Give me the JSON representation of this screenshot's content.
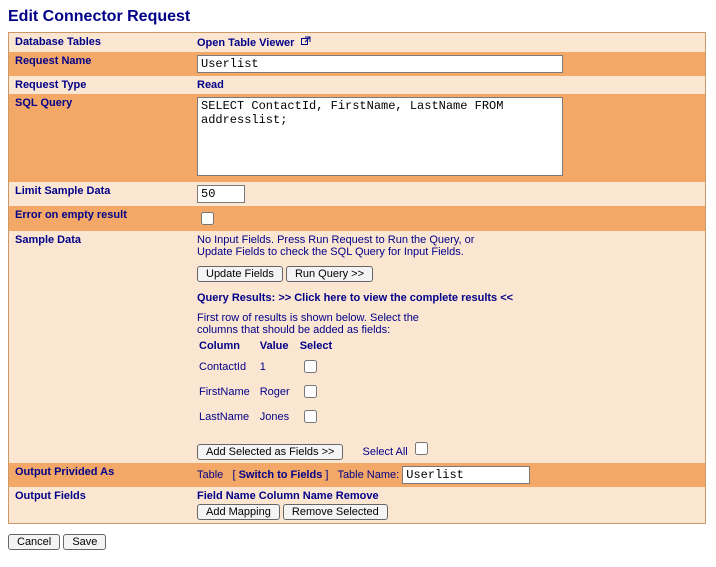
{
  "title": "Edit Connector Request",
  "rows": {
    "databaseTables": {
      "label": "Database Tables",
      "link": "Open Table Viewer"
    },
    "requestName": {
      "label": "Request Name",
      "value": "Userlist"
    },
    "requestType": {
      "label": "Request Type",
      "value": "Read"
    },
    "sqlQuery": {
      "label": "SQL Query",
      "value": "SELECT ContactId, FirstName, LastName FROM addresslist;"
    },
    "limitSample": {
      "label": "Limit Sample Data",
      "value": "50"
    },
    "errorEmpty": {
      "label": "Error on empty result"
    },
    "sampleData": {
      "label": "Sample Data",
      "noInput1": "No Input Fields. Press Run Request to Run the Query, or",
      "noInput2": "Update Fields to check the SQL Query for Input Fields.",
      "updateFieldsBtn": "Update Fields",
      "runQueryBtn": "Run Query >>",
      "resultsHeading": "Query Results:",
      "resultsLink": ">> Click here to view the complete results <<",
      "resultsHint1": "First row of results is shown below. Select the",
      "resultsHint2": "columns that should be added as fields:",
      "gridHeaders": {
        "col": "Column",
        "val": "Value",
        "sel": "Select"
      },
      "gridRows": [
        {
          "col": "ContactId",
          "val": "1"
        },
        {
          "col": "FirstName",
          "val": "Roger"
        },
        {
          "col": "LastName",
          "val": "Jones"
        }
      ],
      "addSelectedBtn": "Add Selected as Fields >>",
      "selectAllLabel": "Select All"
    },
    "outputProvided": {
      "label": "Output Privided As",
      "tableWord": "Table",
      "switchLink": "Switch to Fields",
      "tableNameLabel": "Table Name:",
      "tableNameValue": "Userlist"
    },
    "outputFields": {
      "label": "Output Fields",
      "h1": "Field Name",
      "h2": "Column Name",
      "h3": "Remove",
      "addMappingBtn": "Add Mapping",
      "removeSelectedBtn": "Remove Selected"
    }
  },
  "footer": {
    "cancel": "Cancel",
    "save": "Save"
  }
}
